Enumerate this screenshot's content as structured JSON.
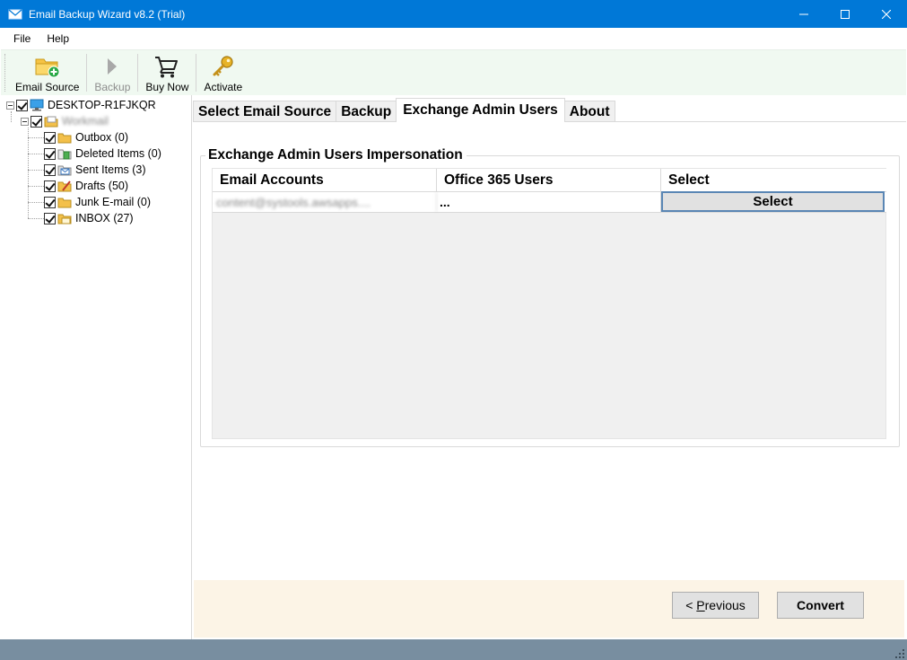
{
  "window": {
    "title": "Email Backup Wizard v8.2 (Trial)"
  },
  "menu": {
    "items": [
      {
        "label": "File"
      },
      {
        "label": "Help"
      }
    ]
  },
  "toolbar": {
    "email_source": "Email Source",
    "backup": "Backup",
    "buy_now": "Buy Now",
    "activate": "Activate"
  },
  "tree": {
    "root": "DESKTOP-R1FJKQR",
    "account": "Workmail",
    "folders": [
      {
        "label": "Outbox (0)",
        "icon": "folder-icon"
      },
      {
        "label": "Deleted Items (0)",
        "icon": "deleted-items-icon"
      },
      {
        "label": "Sent Items (3)",
        "icon": "sent-items-icon"
      },
      {
        "label": "Drafts (50)",
        "icon": "drafts-icon"
      },
      {
        "label": "Junk E-mail (0)",
        "icon": "folder-icon"
      },
      {
        "label": "INBOX (27)",
        "icon": "inbox-icon"
      }
    ]
  },
  "tabs": [
    {
      "label": "Select Email Source",
      "active": false
    },
    {
      "label": "Backup",
      "active": false
    },
    {
      "label": "Exchange Admin Users",
      "active": true
    },
    {
      "label": "About",
      "active": false
    }
  ],
  "group": {
    "title": "Exchange Admin Users Impersonation"
  },
  "grid": {
    "headers": [
      "Email Accounts",
      "Office 365 Users",
      "Select"
    ],
    "rows": [
      {
        "email": "content@systools.awsapps....",
        "users": "...",
        "select": "Select"
      }
    ]
  },
  "buttons": {
    "previous_prefix": "< ",
    "previous_hotkey": "P",
    "previous_rest": "revious",
    "convert": "Convert"
  },
  "colors": {
    "titlebar": "#0078d7",
    "toolbar": "#f0f9f1",
    "footer": "#fcf4e6",
    "statusbar": "#788ea0",
    "select_border": "#5a86b4"
  }
}
